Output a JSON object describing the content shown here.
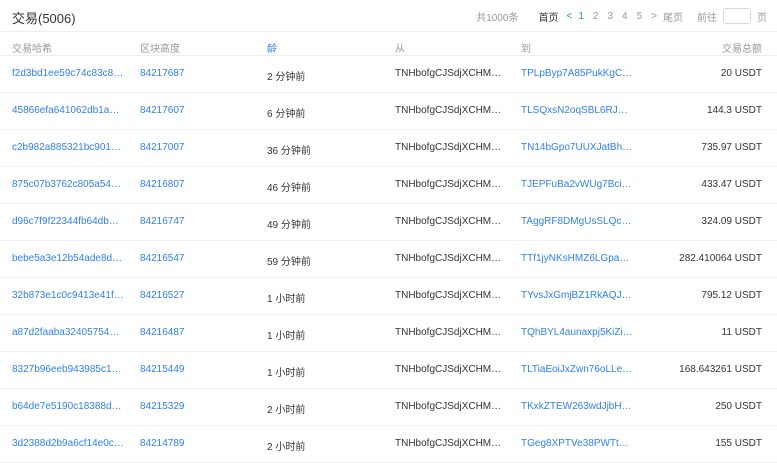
{
  "header": {
    "title": "交易(5006)",
    "total": "共1000条",
    "first": "首页",
    "prev": "<",
    "pages": [
      "1",
      "2",
      "3",
      "4",
      "5"
    ],
    "current_page": "1",
    "next": ">",
    "last": "尾页",
    "goto_label": "前往",
    "goto_value": "",
    "page_unit": "页"
  },
  "columns": {
    "hash": "交易哈希",
    "block": "区块高度",
    "age": "龄",
    "from": "从",
    "to": "到",
    "amount": "交易总额"
  },
  "rows": [
    {
      "hash": "f2d3bd1ee59c74c83c8e0...",
      "block": "84217687",
      "age": "2 分钟前",
      "from": "TNHbofgCJSdjXCHMn9LC...",
      "to": "TPLpByp7A85PukKgC3Kk...",
      "amount": "20 USDT"
    },
    {
      "hash": "45866efa641062db1ab49...",
      "block": "84217607",
      "age": "6 分钟前",
      "from": "TNHbofgCJSdjXCHMn9LC...",
      "to": "TLSQxsN2oqSBL6RJ6RpJ...",
      "amount": "144.3 USDT"
    },
    {
      "hash": "c2b982a885321bc901a2d...",
      "block": "84217007",
      "age": "36 分钟前",
      "from": "TNHbofgCJSdjXCHMn9LC...",
      "to": "TN14bGpo7UUXJatBhD11...",
      "amount": "735.97 USDT"
    },
    {
      "hash": "875c07b3762c805a54d4f...",
      "block": "84216807",
      "age": "46 分钟前",
      "from": "TNHbofgCJSdjXCHMn9LC...",
      "to": "TJEPFuBa2vWUg7Bci2PY...",
      "amount": "433.47 USDT"
    },
    {
      "hash": "d96c7f9f22344fb64db473...",
      "block": "84216747",
      "age": "49 分钟前",
      "from": "TNHbofgCJSdjXCHMn9LC...",
      "to": "TAggRF8DMgUsSLQcnv1K...",
      "amount": "324.09 USDT"
    },
    {
      "hash": "bebe5a3e12b54ade8d173...",
      "block": "84216547",
      "age": "59 分钟前",
      "from": "TNHbofgCJSdjXCHMn9LC...",
      "to": "TTf1jyNKsHMZ6LGpasyFs...",
      "amount": "282.410064 USDT"
    },
    {
      "hash": "32b873e1c0c9413e41f82...",
      "block": "84216527",
      "age": "1 小时前",
      "from": "TNHbofgCJSdjXCHMn9LC...",
      "to": "TYvsJxGmjBZ1RkAQJq3b...",
      "amount": "795.12 USDT"
    },
    {
      "hash": "a87d2faaba32405754cd3...",
      "block": "84216487",
      "age": "1 小时前",
      "from": "TNHbofgCJSdjXCHMn9LC...",
      "to": "TQhBYL4aunaxpj5KiZiJfrg...",
      "amount": "11 USDT"
    },
    {
      "hash": "8327b96eeb943985c1eca...",
      "block": "84215449",
      "age": "1 小时前",
      "from": "TNHbofgCJSdjXCHMn9LC...",
      "to": "TLTiaEoiJxZwn76oLLeme...",
      "amount": "168.643261 USDT"
    },
    {
      "hash": "b64de7e5190c18388df9d...",
      "block": "84215329",
      "age": "2 小时前",
      "from": "TNHbofgCJSdjXCHMn9LC...",
      "to": "TKxkZTEW263wdJjbHvZh...",
      "amount": "250 USDT"
    },
    {
      "hash": "3d2388d2b9a6cf14e0ca7...",
      "block": "84214789",
      "age": "2 小时前",
      "from": "TNHbofgCJSdjXCHMn9LC...",
      "to": "TGeg8XPTVe38PWTtnshC...",
      "amount": "155 USDT"
    }
  ],
  "colors": {
    "accent": "#2f80ed",
    "text": "#333333",
    "muted": "#999999",
    "border": "#eeeeee"
  }
}
